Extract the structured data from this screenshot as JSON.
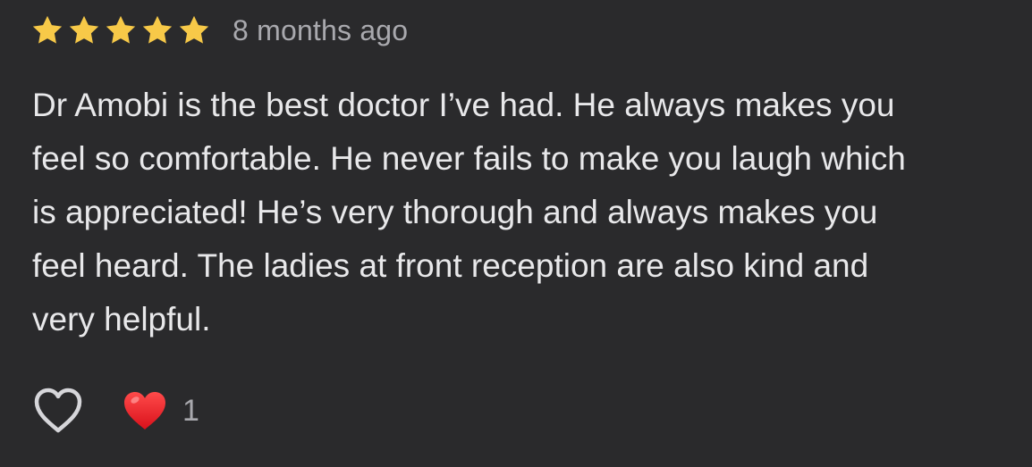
{
  "review": {
    "rating": 5,
    "rating_max": 5,
    "star_color": "#f7c948",
    "time_ago": "8 months ago",
    "text": "Dr Amobi is the best doctor I’ve had. He always makes you\nfeel so comfortable. He never fails to make you laugh which\nis appreciated! He’s very thorough and always makes you\nfeel heard. The ladies at front reception are also kind and\nvery helpful."
  },
  "actions": {
    "like_icon": "heart-outline-icon",
    "reaction_icon": "red-heart-emoji",
    "reaction_count": "1"
  }
}
